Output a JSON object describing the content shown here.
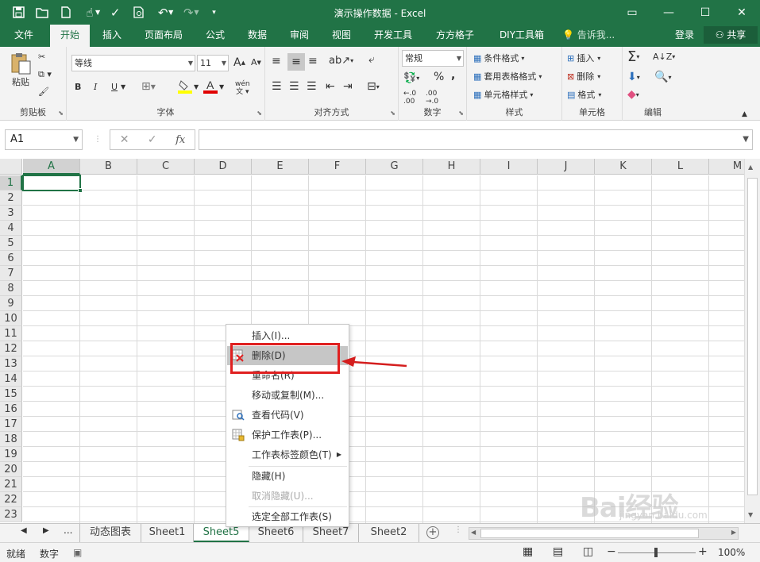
{
  "window": {
    "title": "演示操作数据 - Excel",
    "minimize_glyph": "▭",
    "restore_glyph": "—",
    "maximize_glyph": "☐",
    "close_glyph": "✕"
  },
  "ribbon_tabs": [
    "文件",
    "开始",
    "插入",
    "页面布局",
    "公式",
    "数据",
    "审阅",
    "视图",
    "开发工具",
    "方方格子",
    "DIY工具箱"
  ],
  "active_tab": "开始",
  "tell_me": "告诉我...",
  "login": "登录",
  "share": "共享",
  "groups": {
    "clipboard": {
      "label": "剪贴板",
      "paste": "粘贴"
    },
    "font": {
      "label": "字体",
      "font_name": "等线",
      "font_size": "11",
      "bold": "B",
      "italic": "I",
      "underline": "U",
      "grow": "A",
      "shrink": "A",
      "wen": "wén"
    },
    "alignment": {
      "label": "对齐方式"
    },
    "number": {
      "label": "数字",
      "format": "常规",
      "percent": "%",
      "comma": ","
    },
    "styles": {
      "label": "样式",
      "cond_format": "条件格式",
      "table_format": "套用表格格式",
      "cell_style": "单元格样式"
    },
    "cells": {
      "label": "单元格",
      "insert": "插入",
      "delete": "删除",
      "format": "格式"
    },
    "editing": {
      "label": "编辑"
    }
  },
  "formula_bar": {
    "name_box": "A1",
    "cancel": "✕",
    "enter": "✓",
    "fx": "fx",
    "value": ""
  },
  "columns": [
    "A",
    "B",
    "C",
    "D",
    "E",
    "F",
    "G",
    "H",
    "I",
    "J",
    "K",
    "L",
    "M"
  ],
  "rows": [
    "1",
    "2",
    "3",
    "4",
    "5",
    "6",
    "7",
    "8",
    "9",
    "10",
    "11",
    "12",
    "13",
    "14",
    "15",
    "16",
    "17",
    "18",
    "19",
    "20",
    "21",
    "22",
    "23"
  ],
  "sheet_tabs": [
    "动态图表",
    "Sheet1",
    "Sheet5",
    "Sheet6",
    "Sheet7",
    "Sheet2"
  ],
  "active_sheet": "Sheet5",
  "sheet_nav": {
    "prev": "◀",
    "next": "▶",
    "more": "...",
    "add": "+"
  },
  "status": {
    "ready": "就绪",
    "mode": "数字",
    "zoom": "100%",
    "zoom_minus": "−",
    "zoom_plus": "+"
  },
  "context_menu": [
    {
      "label": "插入(I)...",
      "icon": "none"
    },
    {
      "label": "删除(D)",
      "icon": "delete-sheet-icon",
      "highlighted": true
    },
    {
      "label": "重命名(R)",
      "icon": "none"
    },
    {
      "label": "移动或复制(M)...",
      "icon": "none"
    },
    {
      "label": "查看代码(V)",
      "icon": "view-code-icon"
    },
    {
      "label": "保护工作表(P)...",
      "icon": "protect-sheet-icon"
    },
    {
      "label": "工作表标签颜色(T)",
      "icon": "none",
      "submenu": true
    },
    {
      "label": "隐藏(H)",
      "icon": "none"
    },
    {
      "label": "取消隐藏(U)...",
      "icon": "none",
      "disabled": true
    },
    {
      "label": "选定全部工作表(S)",
      "icon": "none"
    }
  ],
  "watermark": {
    "brand": "Bai经验",
    "url": "jingyan.baidu.com"
  },
  "colors": {
    "excel_green": "#217346",
    "annotation_red": "#e02020"
  }
}
